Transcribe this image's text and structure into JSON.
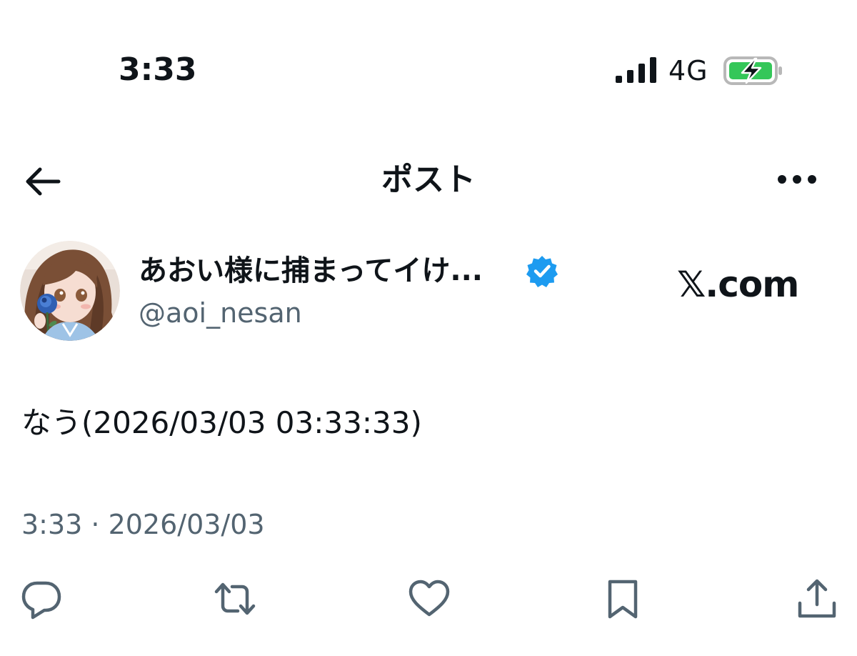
{
  "status_bar": {
    "time": "3:33",
    "network": "4G",
    "battery_color": "#34c759"
  },
  "nav": {
    "title": "ポスト"
  },
  "author": {
    "display_name": "あおい様に捕まってイけ...",
    "handle": "@aoi_nesan",
    "verified_color": "#1d9bf0"
  },
  "watermark": "𝕏.com",
  "post": {
    "text": "なう(2026/03/03 03:33:33)",
    "meta": "3:33 · 2026/03/03"
  },
  "actions": {
    "icons": [
      "reply-icon",
      "repost-icon",
      "like-icon",
      "bookmark-icon",
      "share-icon"
    ],
    "icon_color": "#536471"
  }
}
